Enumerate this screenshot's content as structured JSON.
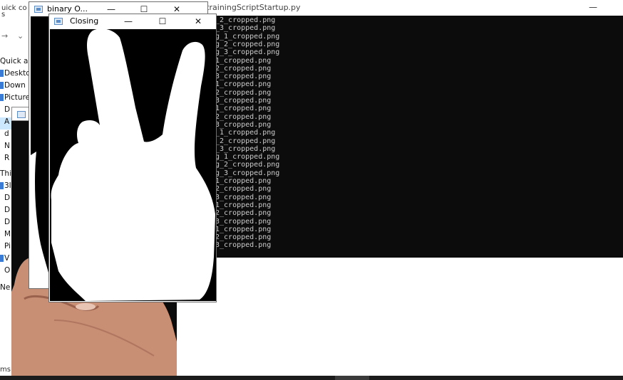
{
  "explorer": {
    "ribbon": [
      "uick",
      "co",
      "s"
    ],
    "nav_items": [
      "Quick a",
      "Deskto",
      "Down",
      "Picture",
      "D",
      "A",
      "d",
      "N",
      "R",
      "Thi",
      "3I",
      "D",
      "D",
      "D",
      "M",
      "Pi",
      "V",
      "O",
      "Ne"
    ],
    "status": "ms"
  },
  "console": {
    "title": "on_trainingScriptStartup.py",
    "minimize": "—",
    "lines": [
      "_2_cropped.png",
      "_3_cropped.png",
      "g_1_cropped.png",
      "g_2_cropped.png",
      "g_3_cropped.png",
      "1_cropped.png",
      "2_cropped.png",
      "3_cropped.png",
      "1_cropped.png",
      "2_cropped.png",
      "3_cropped.png",
      "1_cropped.png",
      "2_cropped.png",
      "3_cropped.png",
      "_1_cropped.png",
      "_2_cropped.png",
      "_3_cropped.png",
      "g_1_cropped.png",
      "g_2_cropped.png",
      "g_3_cropped.png",
      "1_cropped.png",
      "2_cropped.png",
      "3_cropped.png",
      "1_cropped.png",
      "2_cropped.png",
      "3_cropped.png",
      "1_cropped.png",
      "2_cropped.png",
      "3_cropped.png"
    ]
  },
  "binary_window": {
    "title": "binary O...",
    "minimize": "—",
    "maximize": "☐",
    "close": "✕"
  },
  "closing_window": {
    "title": "Closing",
    "minimize": "—",
    "maximize": "☐",
    "close": "✕"
  },
  "colors": {
    "console_bg": "#0c0c0c",
    "console_text": "#cccccc",
    "mask_fg": "#ffffff",
    "mask_bg": "#000000",
    "skin": "#c98f74"
  },
  "icons": [
    "app-window-icon",
    "minimize-icon",
    "maximize-icon",
    "close-icon"
  ]
}
